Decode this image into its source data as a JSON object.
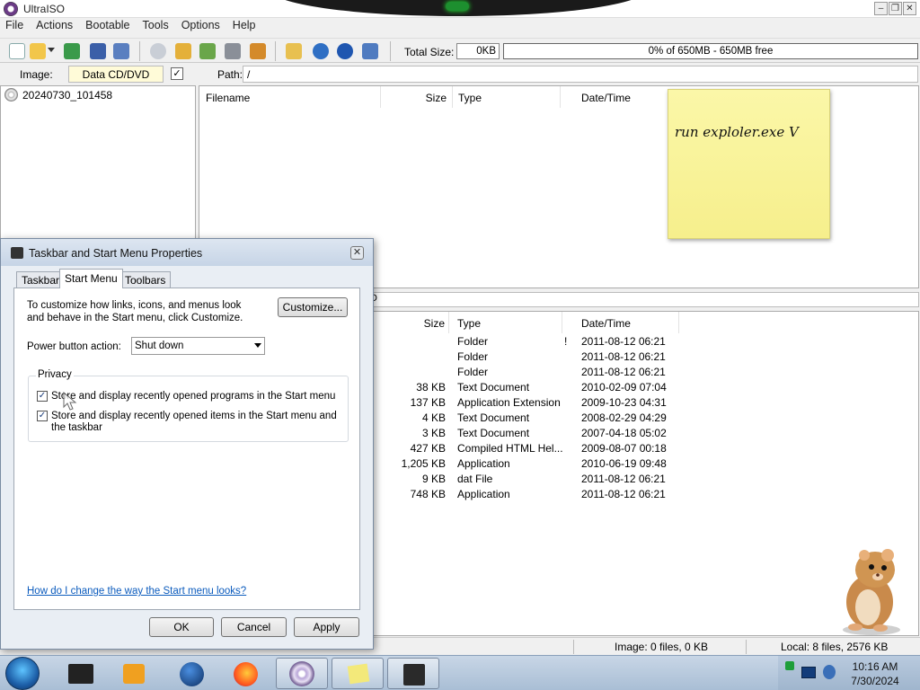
{
  "window": {
    "title": "UltraISO"
  },
  "menu": [
    "File",
    "Actions",
    "Bootable",
    "Tools",
    "Options",
    "Help"
  ],
  "toolbar": {
    "total_size_label": "Total Size:",
    "total_size_value": "0KB",
    "capacity_text": "0% of 650MB - 650MB free",
    "capacity_percent": 0
  },
  "image_bar": {
    "image_label": "Image:",
    "image_type": "Data CD/DVD",
    "path_label": "Path:",
    "path_value": "/"
  },
  "tree": {
    "root": "20240730_101458"
  },
  "upper_list": {
    "columns": [
      "Filename",
      "Size",
      "Type",
      "Date/Time"
    ]
  },
  "sticky_note": {
    "text": "run exploler.exe V"
  },
  "lower_list": {
    "columns": [
      "Size",
      "Type",
      "Date/Time"
    ],
    "rows": [
      {
        "size": "",
        "type": "Folder",
        "flag": "!",
        "date": "2011-08-12 06:21"
      },
      {
        "size": "",
        "type": "Folder",
        "flag": "",
        "date": "2011-08-12 06:21"
      },
      {
        "size": "",
        "type": "Folder",
        "flag": "",
        "date": "2011-08-12 06:21"
      },
      {
        "size": "38 KB",
        "type": "Text Document",
        "flag": "",
        "date": "2010-02-09 07:04"
      },
      {
        "size": "137 KB",
        "type": "Application Extension",
        "flag": "",
        "date": "2009-10-23 04:31"
      },
      {
        "size": "4 KB",
        "type": "Text Document",
        "flag": "",
        "date": "2008-02-29 04:29"
      },
      {
        "size": "3 KB",
        "type": "Text Document",
        "flag": "",
        "date": "2007-04-18 05:02"
      },
      {
        "size": "427 KB",
        "type": "Compiled HTML Hel...",
        "flag": "",
        "date": "2009-08-07 00:18"
      },
      {
        "size": "1,205 KB",
        "type": "Application",
        "flag": "",
        "date": "2010-06-19 09:48"
      },
      {
        "size": "9 KB",
        "type": "dat File",
        "flag": "",
        "date": "2011-08-12 06:21"
      },
      {
        "size": "748 KB",
        "type": "Application",
        "flag": "",
        "date": "2011-08-12 06:21"
      }
    ]
  },
  "status": {
    "image_info": "Image: 0 files, 0 KB",
    "local_info": "Local: 8 files, 2576 KB"
  },
  "dialog": {
    "title": "Taskbar and Start Menu Properties",
    "tabs": [
      "Taskbar",
      "Start Menu",
      "Toolbars"
    ],
    "active_tab": "Start Menu",
    "description": "To customize how links, icons, and menus look and behave in the Start menu, click Customize.",
    "customize_label": "Customize...",
    "power_label": "Power button action:",
    "power_value": "Shut down",
    "privacy_label": "Privacy",
    "checkbox1": {
      "label": "Store and display recently opened programs in the Start menu",
      "checked": true
    },
    "checkbox2": {
      "label": "Store and display recently opened items in the Start menu and the taskbar",
      "checked": true
    },
    "help_link": "How do I change the way the Start menu looks?",
    "ok_label": "OK",
    "cancel_label": "Cancel",
    "apply_label": "Apply"
  },
  "taskbar": {
    "time": "10:16 AM",
    "date": "7/30/2024"
  }
}
